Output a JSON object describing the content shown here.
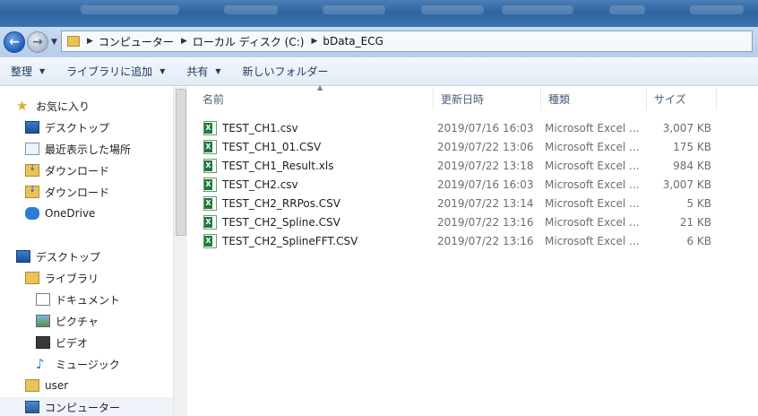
{
  "address": {
    "crumbs": [
      "コンピューター",
      "ローカル ディスク (C:)",
      "bData_ECG"
    ]
  },
  "toolbar": {
    "organize": "整理",
    "add_to_library": "ライブラリに追加",
    "share": "共有",
    "new_folder": "新しいフォルダー"
  },
  "nav": {
    "favorites": "お気に入り",
    "desktop_fav": "デスクトップ",
    "recent": "最近表示した場所",
    "downloads1": "ダウンロード",
    "downloads2": "ダウンロード",
    "onedrive": "OneDrive",
    "desktop": "デスクトップ",
    "libraries": "ライブラリ",
    "documents": "ドキュメント",
    "pictures": "ピクチャ",
    "videos": "ビデオ",
    "music": "ミュージック",
    "user": "user",
    "computer": "コンピューター"
  },
  "columns": {
    "name": "名前",
    "date": "更新日時",
    "type": "種類",
    "size": "サイズ"
  },
  "files": [
    {
      "name": "TEST_CH1.csv",
      "date": "2019/07/16 16:03",
      "type": "Microsoft Excel ...",
      "size": "3,007 KB"
    },
    {
      "name": "TEST_CH1_01.CSV",
      "date": "2019/07/22 13:06",
      "type": "Microsoft Excel ...",
      "size": "175 KB"
    },
    {
      "name": "TEST_CH1_Result.xls",
      "date": "2019/07/22 13:18",
      "type": "Microsoft Excel ...",
      "size": "984 KB"
    },
    {
      "name": "TEST_CH2.csv",
      "date": "2019/07/16 16:03",
      "type": "Microsoft Excel ...",
      "size": "3,007 KB"
    },
    {
      "name": "TEST_CH2_RRPos.CSV",
      "date": "2019/07/22 13:14",
      "type": "Microsoft Excel ...",
      "size": "5 KB"
    },
    {
      "name": "TEST_CH2_Spline.CSV",
      "date": "2019/07/22 13:16",
      "type": "Microsoft Excel ...",
      "size": "21 KB"
    },
    {
      "name": "TEST_CH2_SplineFFT.CSV",
      "date": "2019/07/22 13:16",
      "type": "Microsoft Excel ...",
      "size": "6 KB"
    }
  ]
}
